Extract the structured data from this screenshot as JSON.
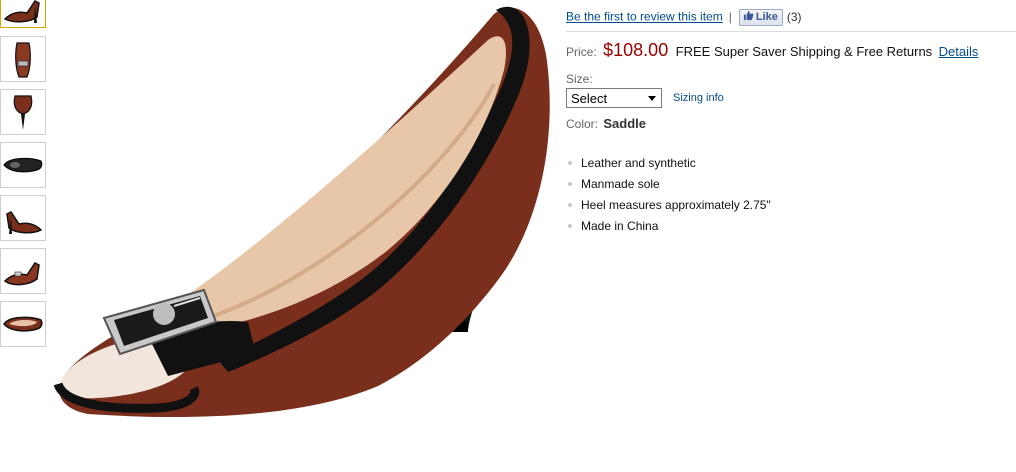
{
  "review": {
    "link_text": "Be the first to review this item",
    "separator": "|",
    "like_label": "Like",
    "like_count": "(3)"
  },
  "price": {
    "label": "Price:",
    "value": "$108.00",
    "shipping_text": "FREE Super Saver Shipping & Free Returns",
    "details_link": "Details"
  },
  "size": {
    "label": "Size:",
    "selected": "Select",
    "sizing_link": "Sizing info"
  },
  "color": {
    "label": "Color:",
    "value": "Saddle"
  },
  "features": [
    "Leather and synthetic",
    "Manmade sole",
    "Heel measures approximately 2.75\"",
    "Made in China"
  ],
  "thumbnails": [
    {
      "view": "side-left",
      "selected": true
    },
    {
      "view": "front"
    },
    {
      "view": "back"
    },
    {
      "view": "sole"
    },
    {
      "view": "side-right"
    },
    {
      "view": "side-angle"
    },
    {
      "view": "top"
    }
  ],
  "colors": {
    "link": "#004b91",
    "price": "#990000",
    "leather": "#7a2f1c",
    "patent": "#111111"
  }
}
